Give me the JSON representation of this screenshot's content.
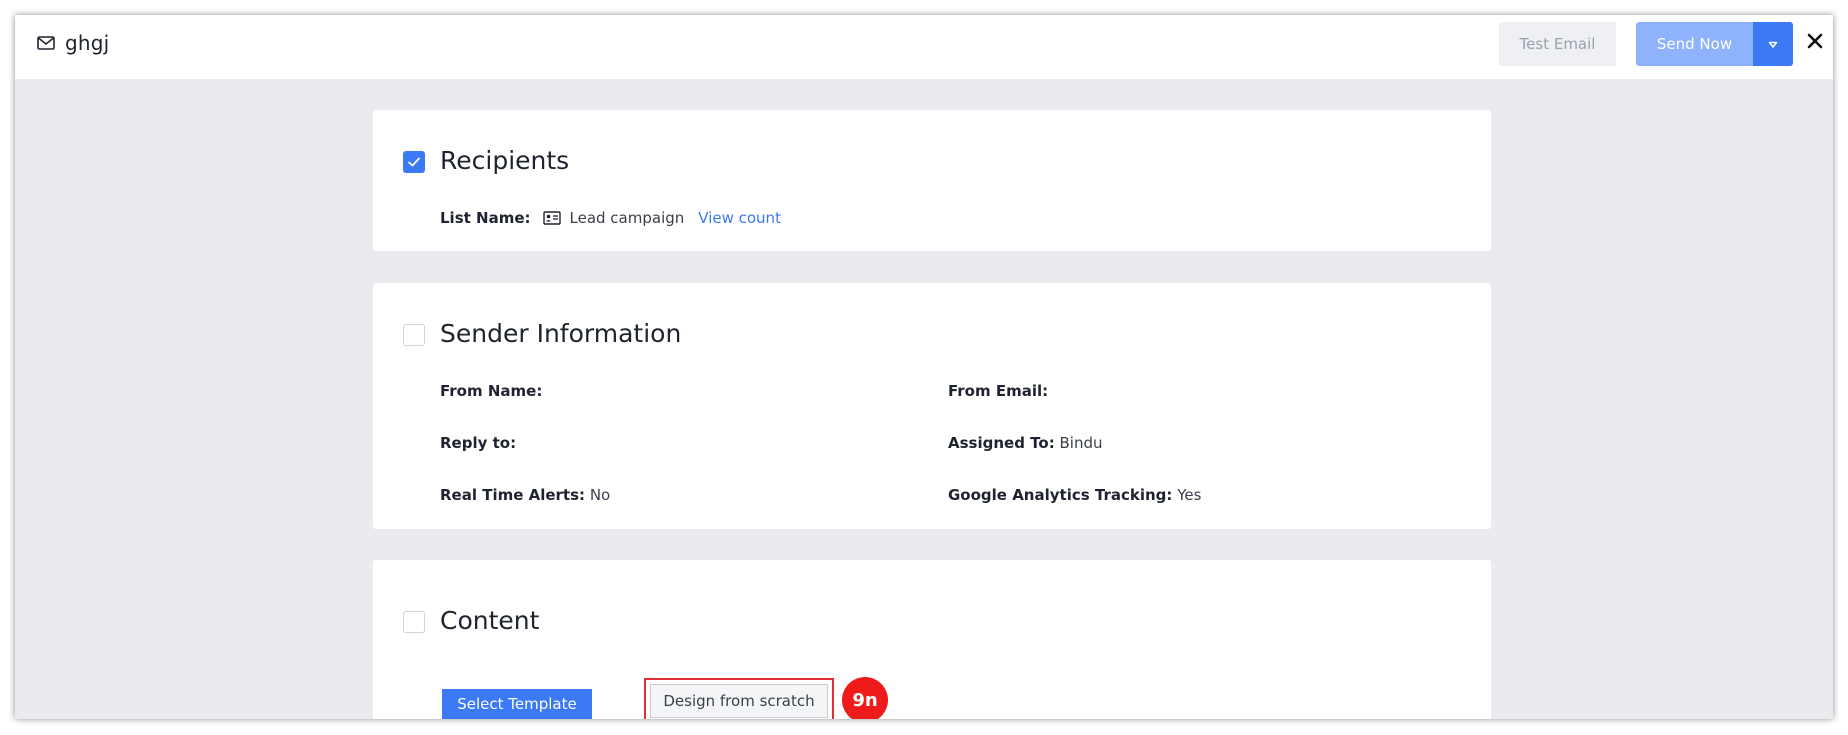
{
  "header": {
    "title": "ghgj",
    "test_email_label": "Test Email",
    "send_now_label": "Send Now"
  },
  "recipients": {
    "title": "Recipients",
    "checked": true,
    "list_name_label": "List Name:",
    "list_name_value": "Lead campaign",
    "view_count_label": "View count"
  },
  "sender": {
    "title": "Sender Information",
    "checked": false,
    "from_name_label": "From Name:",
    "from_email_label": "From Email:",
    "reply_to_label": "Reply to:",
    "assigned_to_label": "Assigned To:",
    "assigned_to_value": "Bindu",
    "real_time_alerts_label": "Real Time Alerts:",
    "real_time_alerts_value": "No",
    "ga_tracking_label": "Google Analytics Tracking:",
    "ga_tracking_value": "Yes"
  },
  "content": {
    "title": "Content",
    "checked": false,
    "select_template_label": "Select Template",
    "design_from_scratch_label": "Design from scratch"
  },
  "annotation": {
    "step_label": "9n"
  },
  "colors": {
    "accent": "#3b79f5",
    "send_now_bg": "#8eb2fb",
    "highlight_border": "#e02e32",
    "badge_bg": "#ee1b1b",
    "page_bg": "#eaebee"
  },
  "icons": {
    "title_icon": "envelope-icon",
    "list_icon": "contact-card-icon",
    "dropdown_icon": "caret-down-icon",
    "close_icon": "close-icon",
    "check_icon": "checkmark-icon"
  }
}
